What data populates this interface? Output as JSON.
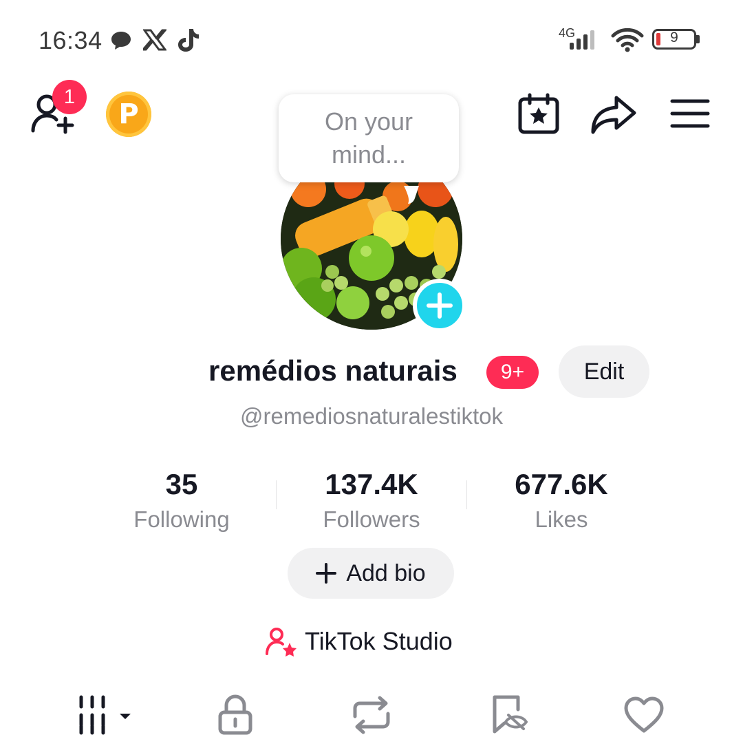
{
  "status_bar": {
    "time": "16:34",
    "network": "4G",
    "battery": "9",
    "icons": [
      "chat-bubble-icon",
      "x-icon",
      "tiktok-icon",
      "signal-icon",
      "wifi-icon",
      "battery-icon"
    ]
  },
  "header": {
    "friend_badge_count": "1",
    "points_label": "P",
    "icons": [
      "add-friend-icon",
      "points-coin-icon",
      "calendar-star-icon",
      "share-icon",
      "menu-icon"
    ]
  },
  "profile": {
    "mind_prompt": "On your mind...",
    "display_name": "remédios naturais",
    "notification_badge": "9+",
    "edit_label": "Edit",
    "username": "@remediosnaturalestiktok"
  },
  "stats": [
    {
      "value": "35",
      "label": "Following"
    },
    {
      "value": "137.4K",
      "label": "Followers"
    },
    {
      "value": "677.6K",
      "label": "Likes"
    }
  ],
  "add_bio_label": "Add bio",
  "studio_label": "TikTok Studio",
  "tabs": [
    "videos-grid-icon",
    "lock-icon",
    "repost-icon",
    "hidden-tag-icon",
    "heart-icon"
  ],
  "colors": {
    "accent": "#fe2c55",
    "avatar_plus": "#20d5ec",
    "coin": "#f9a719",
    "secondary_text": "#8a8b91"
  }
}
